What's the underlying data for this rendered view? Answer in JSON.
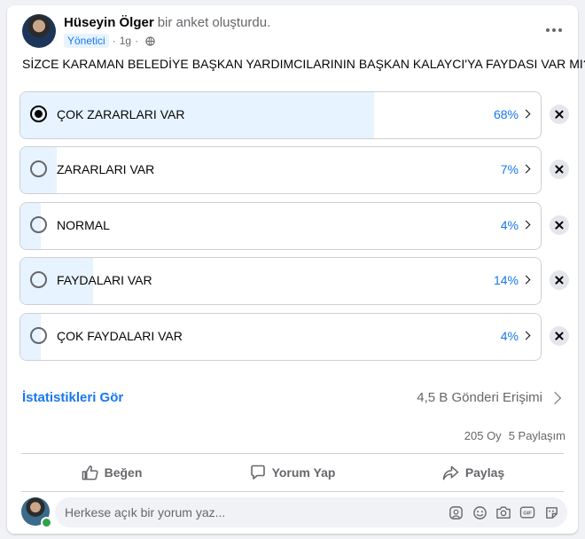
{
  "post": {
    "author_name": "Hüseyin Ölger",
    "action_text": "bir anket oluşturdu.",
    "role_badge": "Yönetici",
    "separator": "·",
    "time": "1g",
    "privacy_icon": "globe-icon",
    "more_icon": "more-dots-icon"
  },
  "poll": {
    "question": "SİZCE KARAMAN BELEDİYE BAŞKAN YARDIMCILARININ BAŞKAN KALAYCI'YA FAYDASI VAR MI?",
    "options": [
      {
        "label": "ÇOK ZARARLARI VAR",
        "percent": "68%",
        "fraction": 0.68,
        "selected": true
      },
      {
        "label": "ZARARLARI VAR",
        "percent": "7%",
        "fraction": 0.07,
        "selected": false
      },
      {
        "label": "NORMAL",
        "percent": "4%",
        "fraction": 0.04,
        "selected": false
      },
      {
        "label": "FAYDALARI VAR",
        "percent": "14%",
        "fraction": 0.14,
        "selected": false
      },
      {
        "label": "ÇOK FAYDALARI VAR",
        "percent": "4%",
        "fraction": 0.04,
        "selected": false
      }
    ],
    "fill_color": "#e7f3ff",
    "accent_color": "#1877f2"
  },
  "insights": {
    "stats_link": "İstatistikleri Gör",
    "reach": "4,5 B Gönderi Erişimi"
  },
  "counts": {
    "votes": "205 Oy",
    "shares": "5 Paylaşım"
  },
  "actions": {
    "like": "Beğen",
    "comment": "Yorum Yap",
    "share": "Paylaş"
  },
  "comment": {
    "placeholder": "Herkese açık bir yorum yaz...",
    "icons": [
      "avatar-sticker-icon",
      "emoji-icon",
      "camera-icon",
      "gif-icon",
      "sticker-icon"
    ]
  }
}
